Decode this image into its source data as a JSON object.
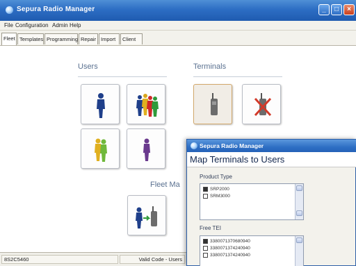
{
  "window": {
    "title": "Sepura Radio Manager"
  },
  "menu": [
    "File",
    "Configuration",
    "Admin",
    "Help"
  ],
  "tabs": [
    "Fleet",
    "Templates",
    "Programming",
    "Repair",
    "Import",
    "Client"
  ],
  "main": {
    "users_title": "Users",
    "terminals_title": "Terminals",
    "fleet_title": "Fleet Ma"
  },
  "statusbar": {
    "left": "8S2C5460",
    "right": "Valid Code - Users"
  },
  "dialog": {
    "title": "Sepura Radio Manager",
    "heading": "Map Terminals to Users",
    "product_type_label": "Product Type",
    "product_types": [
      "SRP2000",
      "SRM3000"
    ],
    "free_tei_label": "Free TEI",
    "free_tei": [
      "3380071370680940",
      "3380071374240940",
      "3380071374240940"
    ]
  },
  "colors": {
    "titlebar": "#2d6ec4",
    "accent": "#5a7190"
  }
}
